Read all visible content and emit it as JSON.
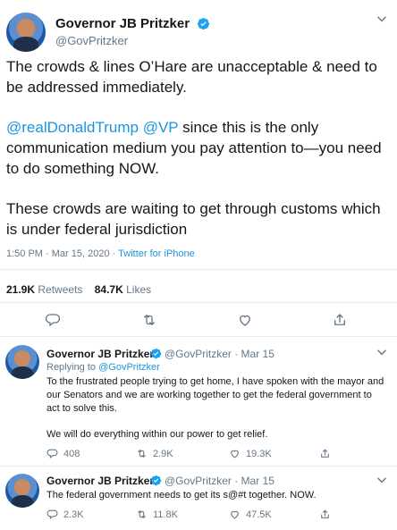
{
  "main_tweet": {
    "author_name": "Governor JB Pritzker",
    "author_handle": "@GovPritzker",
    "text_p1": "The crowds & lines O’Hare are unacceptable & need to be addressed immediately.",
    "mention1": "@realDonaldTrump",
    "mention2": "@VP",
    "text_p2": " since this is the only communication medium you pay attention to—you need to do something NOW.",
    "text_p3": "These crowds are waiting to get through customs which is under federal jurisdiction",
    "time": "1:50 PM",
    "date": "Mar 15, 2020",
    "source": "Twitter for iPhone",
    "retweets_count": "21.9K",
    "retweets_label": "Retweets",
    "likes_count": "84.7K",
    "likes_label": "Likes"
  },
  "replies": [
    {
      "author_name": "Governor JB Pritzker",
      "author_handle": "@GovPritzker",
      "date": "Mar 15",
      "replying_label": "Replying to",
      "replying_handle": "@GovPritzker",
      "text_p1": "To the frustrated people trying to get home, I have spoken with the mayor and our Senators and we are working together to get the federal government to act to solve this.",
      "text_p2": "We will do everything within our power to get relief.",
      "replies": "408",
      "retweets": "2.9K",
      "likes": "19.3K"
    },
    {
      "author_name": "Governor JB Pritzker",
      "author_handle": "@GovPritzker",
      "date": "Mar 15",
      "text_p1": "The federal government needs to get its s@#t together.  NOW.",
      "replies": "2.3K",
      "retweets": "11.8K",
      "likes": "47.5K"
    }
  ],
  "colors": {
    "accent": "#1b95e0",
    "muted": "#657786",
    "border": "#e6ecf0"
  },
  "icons": [
    "verified-icon",
    "caret-down-icon",
    "reply-icon",
    "retweet-icon",
    "like-icon",
    "share-icon"
  ]
}
